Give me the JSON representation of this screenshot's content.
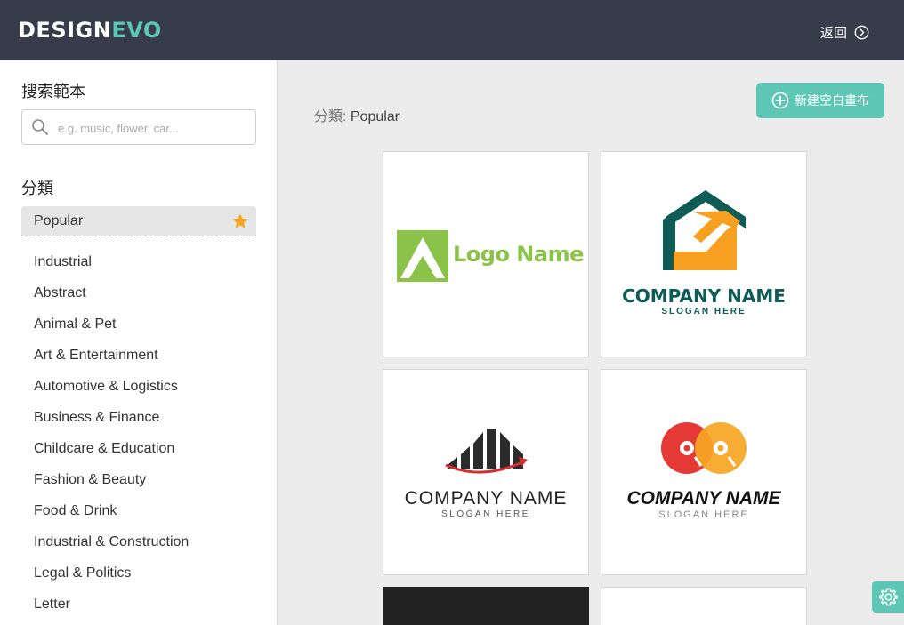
{
  "header": {
    "brand_part1": "DESIGN",
    "brand_part2": "EVO",
    "back_label": "返回"
  },
  "sidebar": {
    "search_title": "搜索範本",
    "search_placeholder": "e.g. music, flower, car...",
    "category_title": "分類",
    "active_category": "Popular",
    "categories": [
      "Industrial",
      "Abstract",
      "Animal & Pet",
      "Art & Entertainment",
      "Automotive & Logistics",
      "Business & Finance",
      "Childcare & Education",
      "Fashion & Beauty",
      "Food & Drink",
      "Industrial & Construction",
      "Legal & Politics",
      "Letter"
    ]
  },
  "main": {
    "crumb_prefix": "分類:",
    "crumb_value": "Popular",
    "new_canvas_label": "新建空白畫布",
    "templates": [
      {
        "name": "Logo Name"
      },
      {
        "name": "COMPANY NAME",
        "slogan": "SLOGAN HERE"
      },
      {
        "name": "COMPANY NAME",
        "slogan": "SLOGAN HERE"
      },
      {
        "name": "COMPANY NAME",
        "slogan": "SLOGAN HERE"
      }
    ]
  },
  "colors": {
    "accent": "#5ec6b5",
    "topbar": "#373c4a",
    "star": "#f5a623",
    "logo_green": "#8bc34a",
    "house_teal": "#0d5c55",
    "house_orange": "#f7a021",
    "chart_red": "#d32f2f",
    "disc_red": "#e53935",
    "disc_orange": "#f6a623"
  },
  "icons": {
    "back": "circle-chevron-right-icon",
    "search": "magnifier-icon",
    "star": "star-icon",
    "new": "circle-plus-icon",
    "settings": "gear-icon"
  }
}
